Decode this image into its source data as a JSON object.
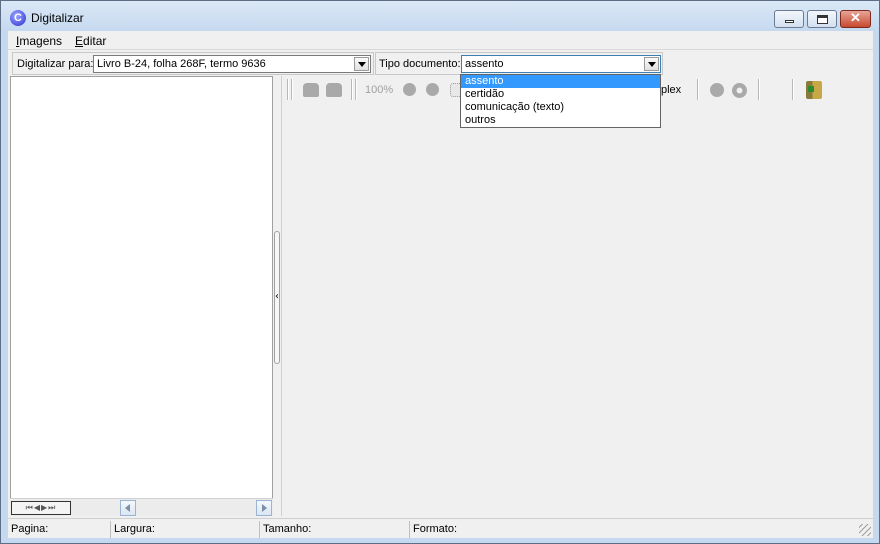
{
  "window": {
    "title": "Digitalizar",
    "app_icon_glyph": "C"
  },
  "menubar": {
    "items": [
      {
        "label_underlined": "I",
        "label_rest": "magens"
      },
      {
        "label_underlined": "E",
        "label_rest": "ditar"
      }
    ]
  },
  "scan_target": {
    "label": "Digitalizar para:",
    "value": "Livro B-24, folha 268F, termo 9636"
  },
  "doc_type": {
    "label": "Tipo documento:",
    "value": "assento",
    "options": [
      "assento",
      "certidão",
      "comunicação (texto)",
      "outros"
    ],
    "selected_index": 0
  },
  "toolbar": {
    "zoom_label": "100%",
    "duplex_label": "plex",
    "icons": [
      "scanner-icon",
      "scanner-icon",
      "zoom-in-icon",
      "zoom-out-icon",
      "fit-page-icon",
      "stop-icon",
      "settings-gear-icon",
      "exit-icon"
    ]
  },
  "thumbnail_nav": {
    "glyphs": "⏮◀▶⏭"
  },
  "statusbar": {
    "page_label": "Pagina:",
    "width_label": "Largura:",
    "size_label": "Tamanho:",
    "format_label": "Formato:"
  },
  "colors": {
    "title_bg": "#c5d9ef",
    "selection": "#3399ff",
    "close_button": "#c6492f"
  }
}
